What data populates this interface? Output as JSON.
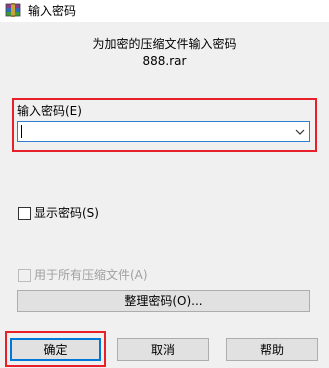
{
  "window": {
    "title": "输入密码"
  },
  "header": {
    "prompt": "为加密的压缩文件输入密码",
    "archive_name": "888.rar"
  },
  "password": {
    "label": "输入密码(E)",
    "value": ""
  },
  "options": {
    "show_password": {
      "label": "显示密码(S)",
      "checked": false
    },
    "use_for_all": {
      "label": "用于所有压缩文件(A)",
      "checked": false,
      "enabled": false
    }
  },
  "buttons": {
    "organize": "整理密码(O)...",
    "ok": "确定",
    "cancel": "取消",
    "help": "帮助"
  },
  "colors": {
    "highlight_frame": "#e8202a",
    "focus_blue": "#0078d7"
  }
}
